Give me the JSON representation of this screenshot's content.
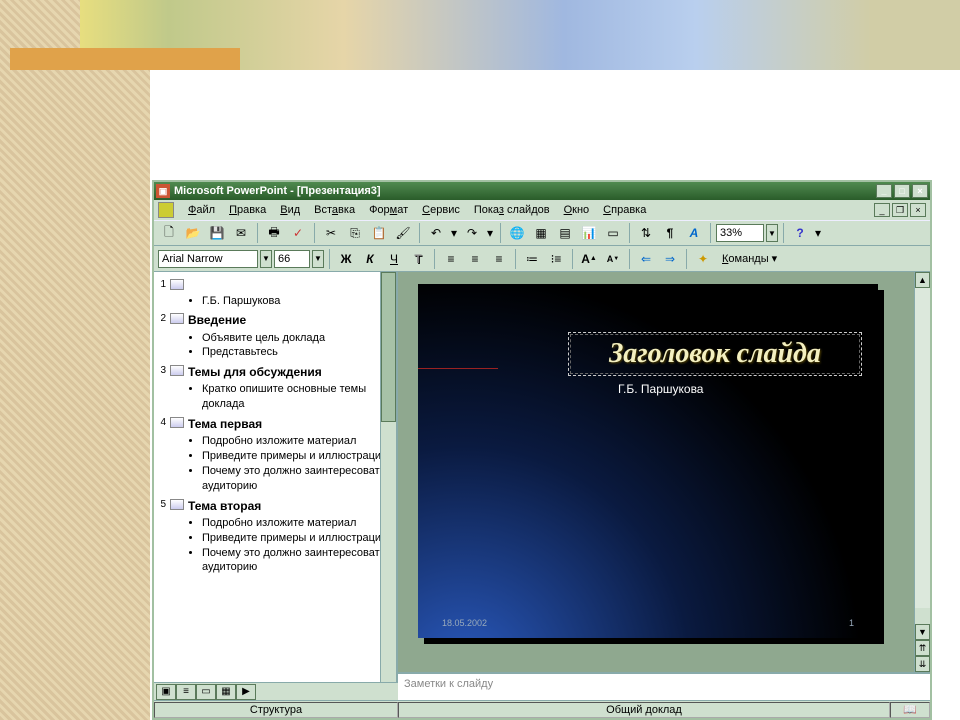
{
  "window": {
    "title": "Microsoft PowerPoint - [Презентация3]"
  },
  "menu": {
    "file": "Файл",
    "edit": "Правка",
    "view": "Вид",
    "insert": "Вставка",
    "format": "Формат",
    "tools": "Сервис",
    "slideshow": "Показ слайдов",
    "window": "Окно",
    "help": "Справка"
  },
  "toolbar": {
    "zoom": "33%"
  },
  "format": {
    "font": "Arial Narrow",
    "size": "66",
    "commands": "Команды"
  },
  "outline": {
    "slides": [
      {
        "num": "1",
        "title": "",
        "bullets": [
          "Г.Б. Паршукова"
        ]
      },
      {
        "num": "2",
        "title": "Введение",
        "bullets": [
          "Объявите цель доклада",
          "Представьтесь"
        ]
      },
      {
        "num": "3",
        "title": "Темы для обсуждения",
        "bullets": [
          "Кратко опишите основные темы доклада"
        ]
      },
      {
        "num": "4",
        "title": "Тема первая",
        "bullets": [
          "Подробно изложите материал",
          "Приведите примеры и иллюстрации",
          "Почему это должно заинтересовать аудиторию"
        ]
      },
      {
        "num": "5",
        "title": "Тема вторая",
        "bullets": [
          "Подробно изложите материал",
          "Приведите примеры и иллюстрации",
          "Почему это должно заинтересовать аудиторию"
        ]
      }
    ]
  },
  "slide": {
    "title": "Заголовок слайда",
    "subtitle": "Г.Б. Паршукова",
    "date": "18.05.2002",
    "pagenum": "1"
  },
  "notes": {
    "placeholder": "Заметки к слайду"
  },
  "status": {
    "left": "Структура",
    "center": "Общий доклад"
  }
}
